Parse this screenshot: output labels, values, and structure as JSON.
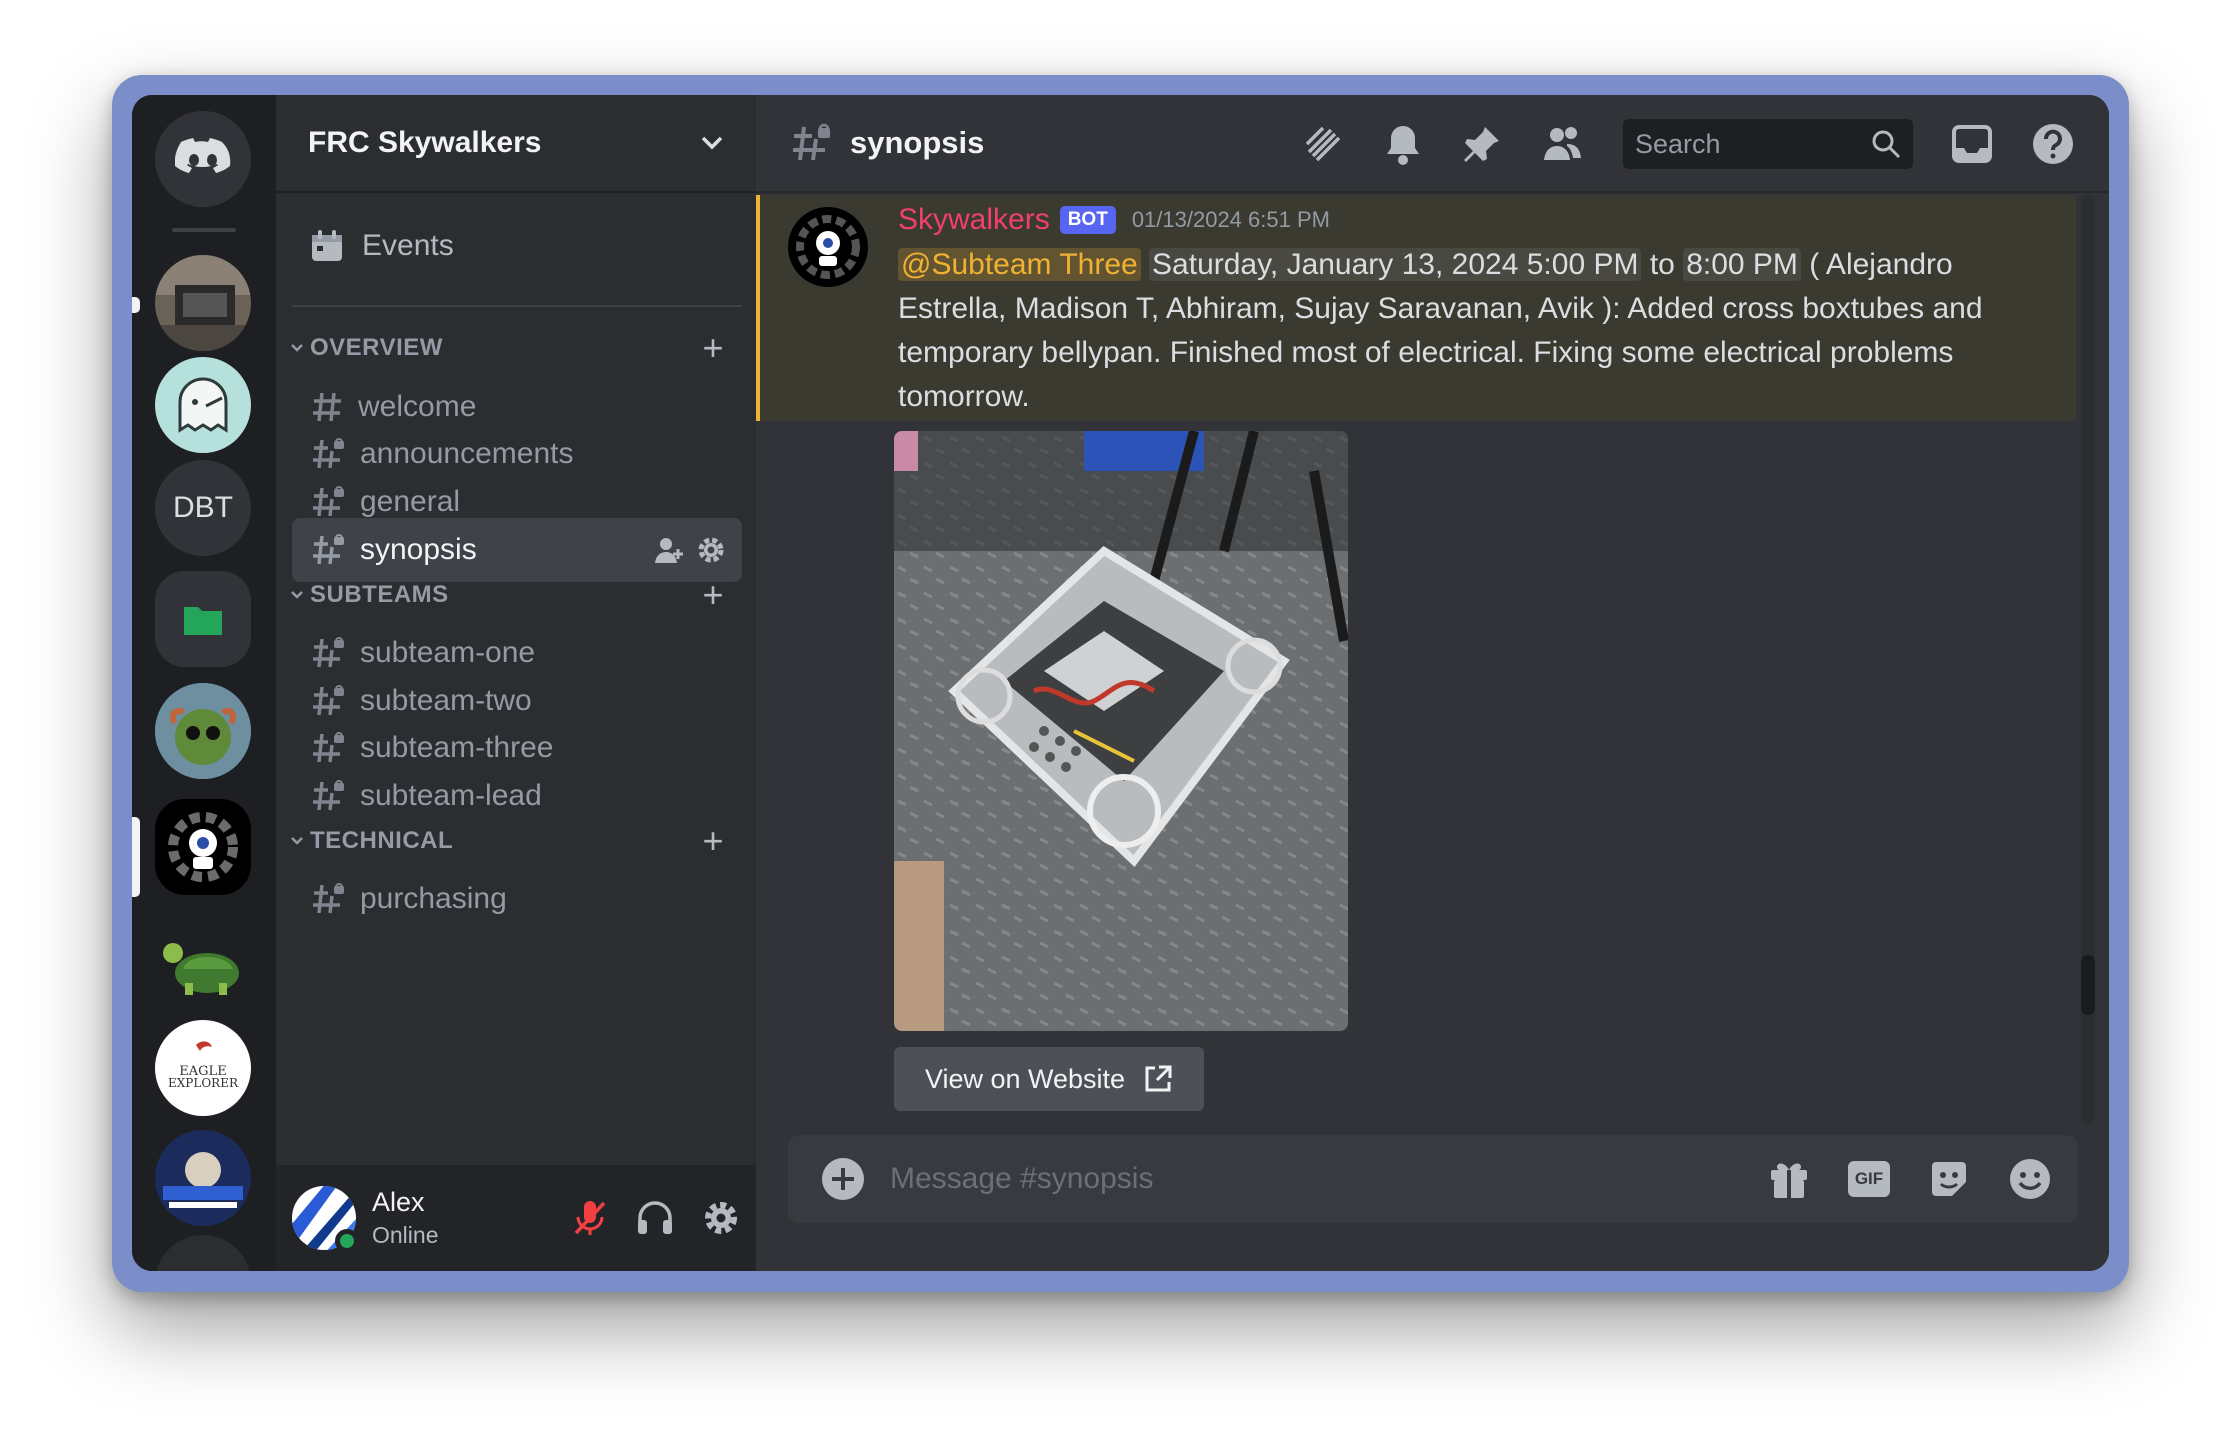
{
  "guild": {
    "name": "FRC Skywalkers"
  },
  "rail": {
    "home_label": "Discord home",
    "servers": [
      {
        "label": ""
      },
      {
        "label": ""
      },
      {
        "label": "DBT"
      },
      {
        "label": ""
      },
      {
        "label": ""
      },
      {
        "label": ""
      },
      {
        "label": ""
      },
      {
        "label": ""
      },
      {
        "label": ""
      }
    ]
  },
  "sidebar": {
    "events_label": "Events",
    "categories": [
      {
        "name": "OVERVIEW",
        "channels": [
          "welcome",
          "announcements",
          "general",
          "synopsis"
        ]
      },
      {
        "name": "SUBTEAMS",
        "channels": [
          "subteam-one",
          "subteam-two",
          "subteam-three",
          "subteam-lead"
        ]
      },
      {
        "name": "TECHNICAL",
        "channels": [
          "purchasing"
        ]
      }
    ],
    "active_channel": "synopsis"
  },
  "user": {
    "name": "Alex",
    "status": "Online"
  },
  "channel": {
    "title": "synopsis"
  },
  "search": {
    "placeholder": "Search"
  },
  "message": {
    "author": "Skywalkers",
    "badge": "BOT",
    "timestamp": "01/13/2024 6:51 PM",
    "mention": "@Subteam Three",
    "time_start": "Saturday, January 13, 2024 5:00 PM",
    "to": "to",
    "time_end": "8:00 PM",
    "text": "( Alejandro Estrella, Madison T, Abhiram, Sujay Saravanan, Avik ): Added cross boxtubes and temporary bellypan. Finished most of electrical. Fixing some electrical problems tomorrow.",
    "link_button": "View on Website"
  },
  "composer": {
    "placeholder": "Message #synopsis",
    "gif_label": "GIF"
  },
  "colors": {
    "accent": "#5865f2",
    "mention": "#f0b232",
    "author": "#f23f6f",
    "online": "#23a55a"
  }
}
